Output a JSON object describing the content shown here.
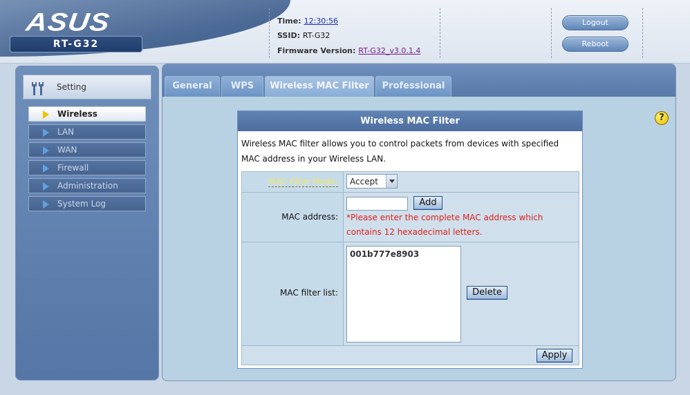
{
  "header": {
    "brand": "ASUS",
    "model": "RT-G32",
    "time_label": "Time:",
    "time_value": "12:30:56",
    "ssid_label": "SSID:",
    "ssid_value": "RT-G32",
    "firmware_label": "Firmware Version:",
    "firmware_value": "RT-G32_v3.0.1.4",
    "logout_label": "Logout",
    "reboot_label": "Reboot"
  },
  "sidebar": {
    "setting_label": "Setting",
    "items": [
      {
        "label": "Wireless",
        "active": true
      },
      {
        "label": "LAN",
        "active": false
      },
      {
        "label": "WAN",
        "active": false
      },
      {
        "label": "Firewall",
        "active": false
      },
      {
        "label": "Administration",
        "active": false
      },
      {
        "label": "System Log",
        "active": false
      }
    ]
  },
  "tabs": [
    {
      "label": "General"
    },
    {
      "label": "WPS"
    },
    {
      "label": "Wireless MAC Filter",
      "active": true
    },
    {
      "label": "Professional"
    }
  ],
  "help_icon": "?",
  "form": {
    "title": "Wireless MAC Filter",
    "description": "Wireless MAC filter allows you to control packets from devices with specified MAC address in your Wireless LAN.",
    "mode_label": "MAC Filter Mode:",
    "mode_value": "Accept",
    "mac_label": "MAC address:",
    "mac_value": "",
    "add_label": "Add",
    "warning": "*Please enter the complete MAC address which contains 12 hexadecimal letters.",
    "list_label": "MAC filter list:",
    "list_items": [
      "001b777e8903"
    ],
    "delete_label": "Delete",
    "apply_label": "Apply"
  },
  "colors": {
    "accent": "#4c6d9e",
    "warning": "#e0211a",
    "active_arrow": "#f0c400"
  }
}
